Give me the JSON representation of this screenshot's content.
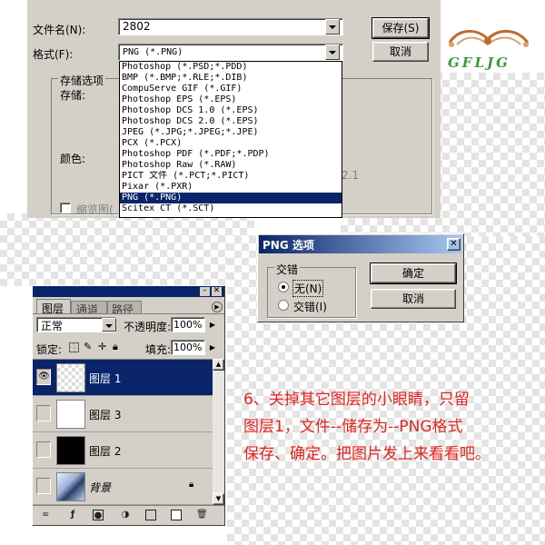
{
  "save_dialog": {
    "filename_label": "文件名(N):",
    "filename_value": "2802",
    "format_label": "格式(F):",
    "format_value": "PNG (*.PNG)",
    "save_button": "保存(S)",
    "cancel_button": "取消",
    "options_group": "存储选项",
    "storage_label": "存储:",
    "color_label": "颜色:",
    "thumbnail_label": "缩览图(",
    "partial_value": "2.1",
    "format_list": [
      "Photoshop (*.PSD;*.PDD)",
      "BMP (*.BMP;*.RLE;*.DIB)",
      "CompuServe GIF (*.GIF)",
      "Photoshop EPS (*.EPS)",
      "Photoshop DCS 1.0 (*.EPS)",
      "Photoshop DCS 2.0 (*.EPS)",
      "JPEG (*.JPG;*.JPEG;*.JPE)",
      "PCX (*.PCX)",
      "Photoshop PDF (*.PDF;*.PDP)",
      "Photoshop Raw (*.RAW)",
      "PICT 文件 (*.PCT;*.PICT)",
      "Pixar (*.PXR)",
      "PNG (*.PNG)",
      "Scitex CT (*.SCT)"
    ],
    "selected_format_index": 12
  },
  "png_dialog": {
    "title": "PNG 选项",
    "group_label": "交错",
    "option_none": "无(N)",
    "option_interlaced": "交错(I)",
    "ok_button": "确定",
    "cancel_button": "取消"
  },
  "layers_panel": {
    "tab_layers": "图层",
    "tab_channels": "通道",
    "tab_paths": "路径",
    "blend_mode": "正常",
    "opacity_label": "不透明度:",
    "opacity_value": "100%",
    "lock_label": "锁定:",
    "fill_label": "填充:",
    "fill_value": "100%",
    "layers": [
      {
        "name": "图层 1",
        "visible": true,
        "selected": true,
        "thumb": "transparent"
      },
      {
        "name": "图层 3",
        "visible": false,
        "selected": false,
        "thumb": "white"
      },
      {
        "name": "图层 2",
        "visible": false,
        "selected": false,
        "thumb": "black"
      },
      {
        "name": "背景",
        "visible": false,
        "selected": false,
        "thumb": "photo"
      }
    ]
  },
  "instructions": {
    "line1": "6、关掉其它图层的小眼睛，只留",
    "line2": "图层1，文件--储存为--PNG格式",
    "line3": "保存、确定。把图片发上来看看吧。"
  },
  "logo": {
    "text": "GFLJG"
  },
  "colors": {
    "dialog_gray": "#d4d0c8",
    "selection_blue": "#0a246a",
    "instruction_red": "#e8231e",
    "logo_green": "#3a9a3a"
  }
}
